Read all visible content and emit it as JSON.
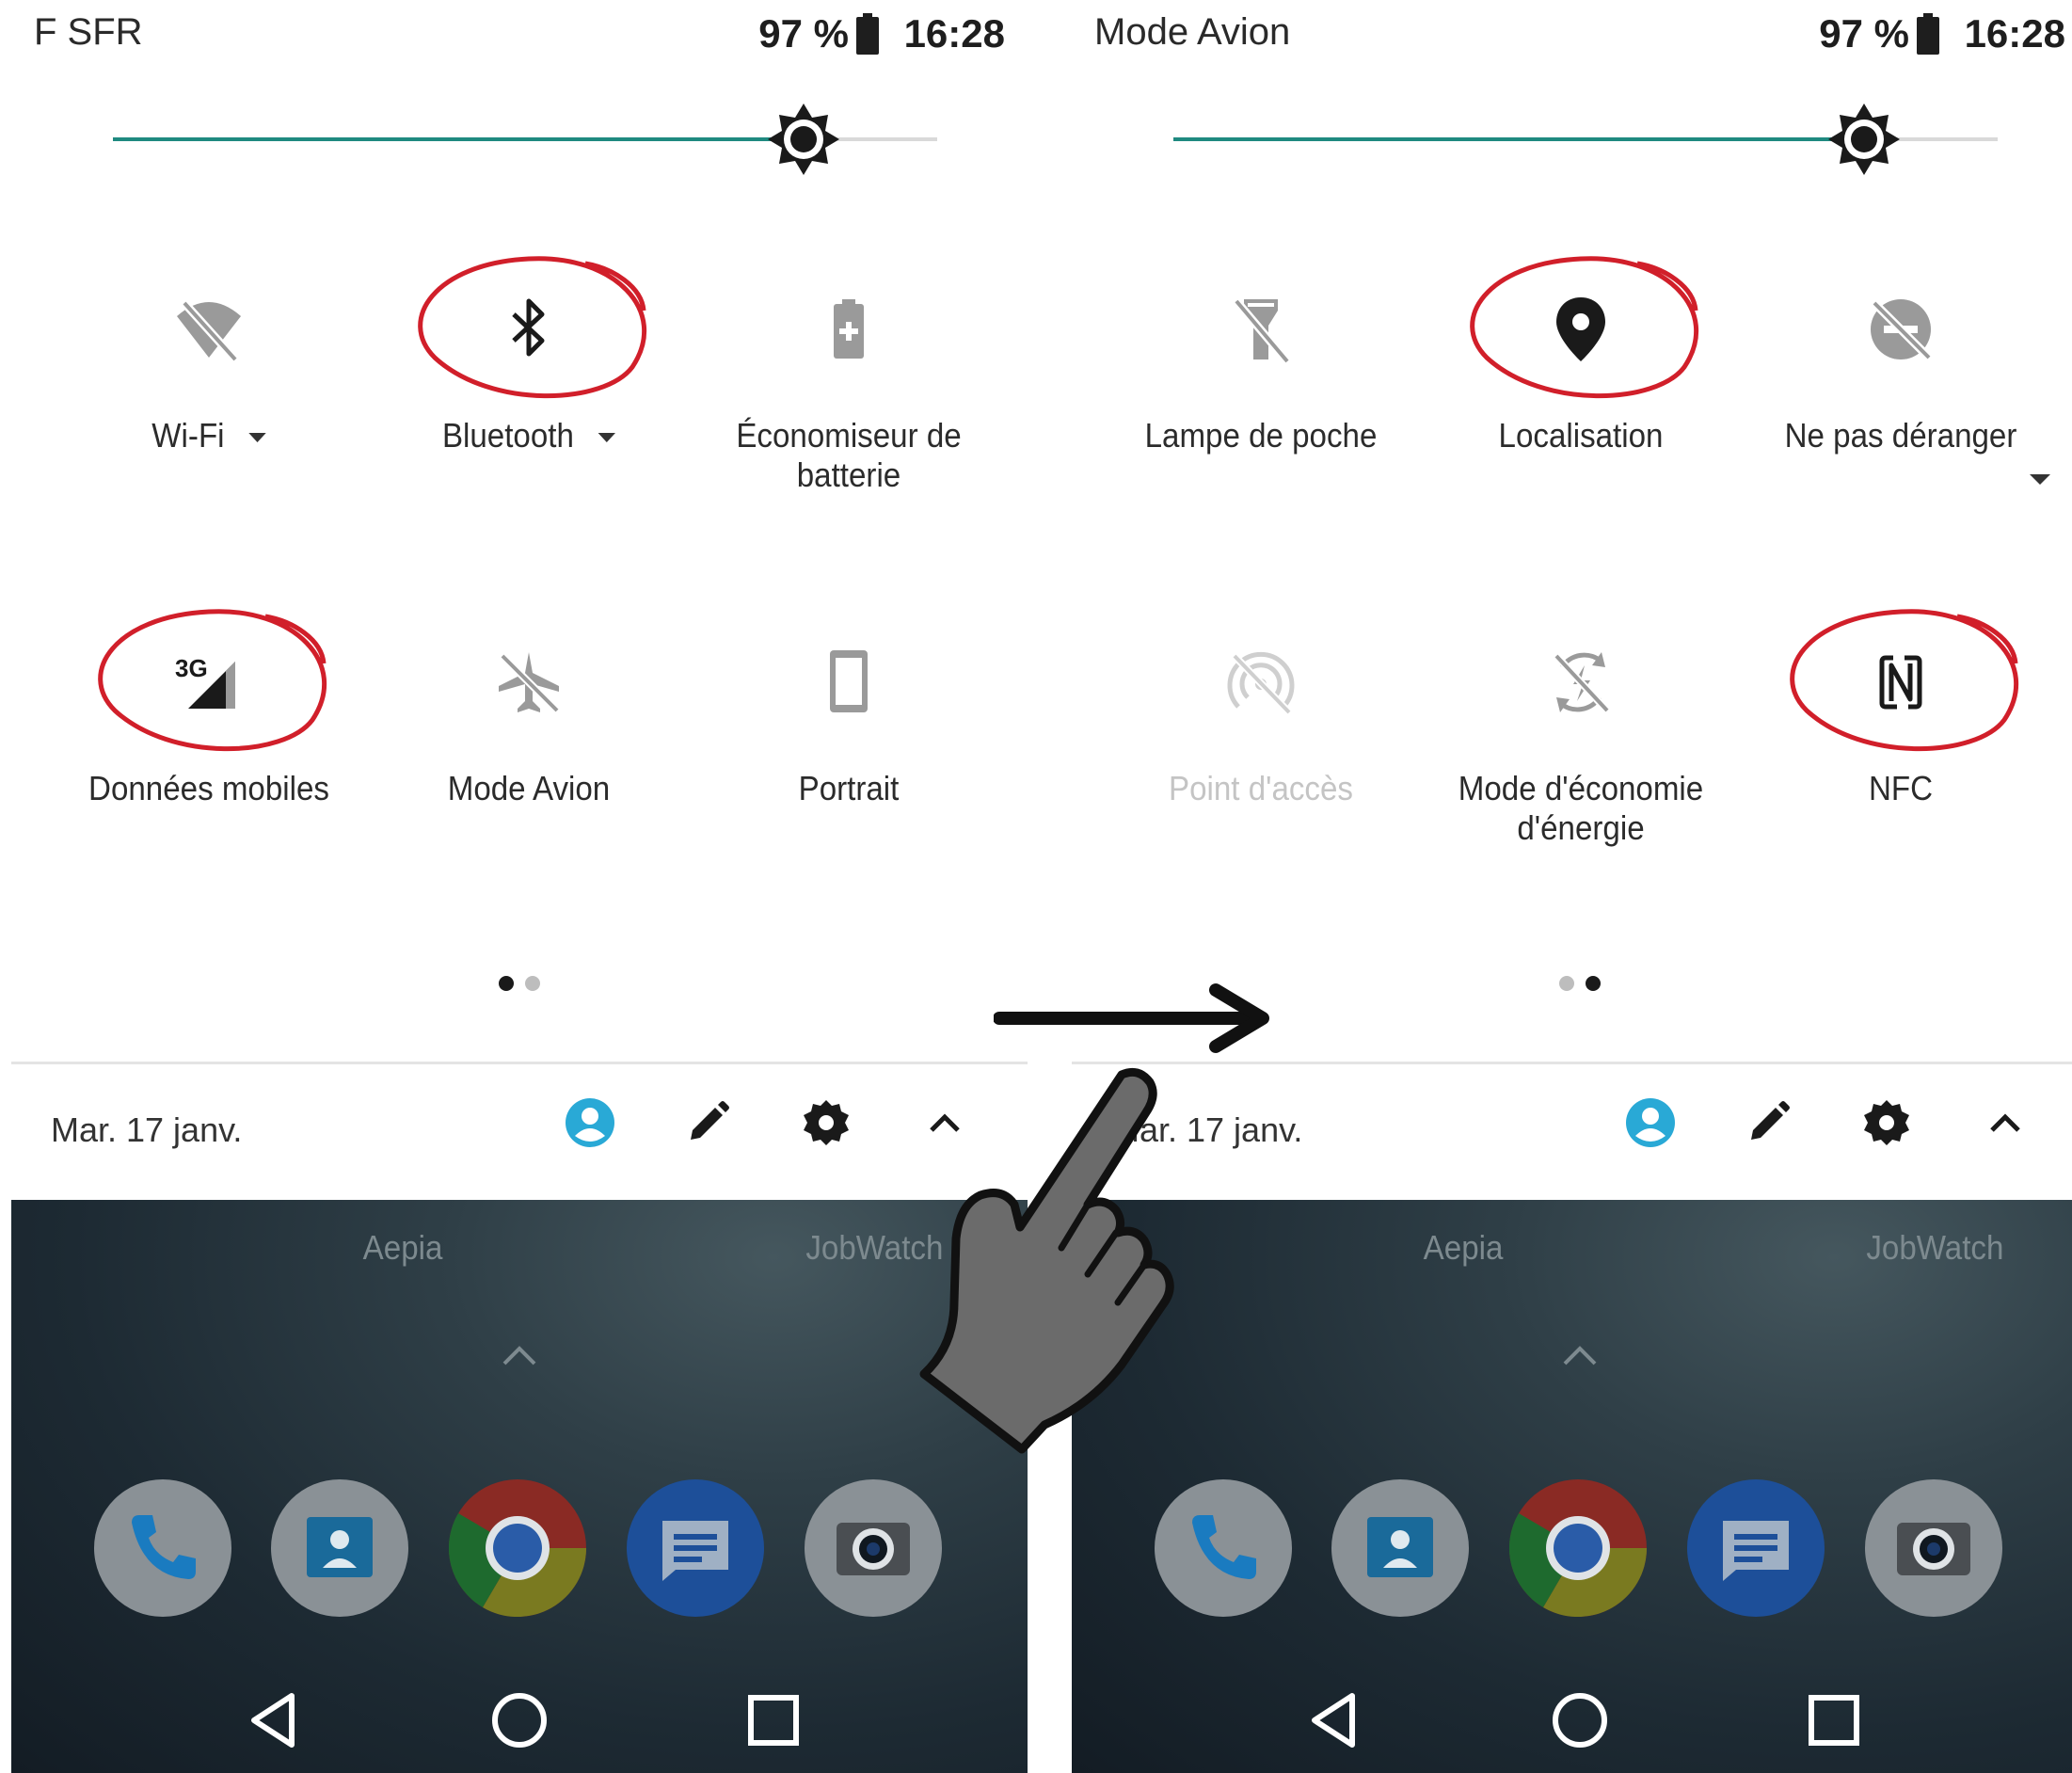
{
  "colors": {
    "accent": "#1f8a80",
    "annotation": "#d11f2a",
    "account": "#29a9d6",
    "text": "#2b2b2b",
    "disabled": "#c4c4c4"
  },
  "left": {
    "status": {
      "carrier": "F SFR",
      "battery": "97 %",
      "time": "16:28"
    },
    "brightness_level": 0.83,
    "tiles": [
      {
        "label": "Wi-Fi",
        "icon": "wifi-off-icon",
        "state": "off",
        "dropdown": true,
        "highlighted": false
      },
      {
        "label": "Bluetooth",
        "icon": "bluetooth-icon",
        "state": "on",
        "dropdown": true,
        "highlighted": true
      },
      {
        "label": "Économiseur de batterie",
        "icon": "battery-saver-icon",
        "state": "off",
        "dropdown": false,
        "highlighted": false
      },
      {
        "label": "Données mobiles",
        "icon": "mobile-data-3g-icon",
        "state": "on",
        "dropdown": false,
        "highlighted": true
      },
      {
        "label": "Mode Avion",
        "icon": "airplane-mode-off-icon",
        "state": "off",
        "dropdown": false,
        "highlighted": false
      },
      {
        "label": "Portrait",
        "icon": "portrait-icon",
        "state": "off",
        "dropdown": false,
        "highlighted": false
      }
    ],
    "page_indicator": {
      "current": 1,
      "total": 2
    },
    "footer": {
      "date": "Mar. 17 janv."
    },
    "home": {
      "apps": [
        "Aepia",
        "JobWatch"
      ]
    }
  },
  "right": {
    "status": {
      "carrier": "Mode Avion",
      "battery": "97 %",
      "time": "16:28"
    },
    "brightness_level": 0.83,
    "tiles": [
      {
        "label": "Lampe de poche",
        "icon": "flashlight-off-icon",
        "state": "off",
        "dropdown": false,
        "highlighted": false
      },
      {
        "label": "Localisation",
        "icon": "location-pin-icon",
        "state": "on",
        "dropdown": false,
        "highlighted": true
      },
      {
        "label": "Ne pas déranger",
        "icon": "do-not-disturb-off-icon",
        "state": "off",
        "dropdown": true,
        "highlighted": false
      },
      {
        "label": "Point d'accès",
        "icon": "hotspot-off-icon",
        "state": "disabled",
        "dropdown": false,
        "highlighted": false
      },
      {
        "label": "Mode d'économie d'énergie",
        "icon": "power-saving-off-icon",
        "state": "off",
        "dropdown": false,
        "highlighted": false
      },
      {
        "label": "NFC",
        "icon": "nfc-icon",
        "state": "on",
        "dropdown": false,
        "highlighted": true
      }
    ],
    "page_indicator": {
      "current": 2,
      "total": 2
    },
    "footer": {
      "date": "Mar. 17 janv."
    },
    "home": {
      "apps": [
        "Aepia",
        "JobWatch"
      ]
    }
  },
  "footer_icons": [
    "account-icon",
    "edit-pencil-icon",
    "settings-gear-icon",
    "collapse-chevron-icon"
  ],
  "dock": [
    "phone-app-icon",
    "contacts-app-icon",
    "chrome-app-icon",
    "messages-app-icon",
    "camera-app-icon"
  ],
  "navbar": [
    "back-icon",
    "home-icon",
    "recents-icon"
  ],
  "overlay": [
    "swipe-arrow-icon",
    "hand-pointer-icon"
  ]
}
